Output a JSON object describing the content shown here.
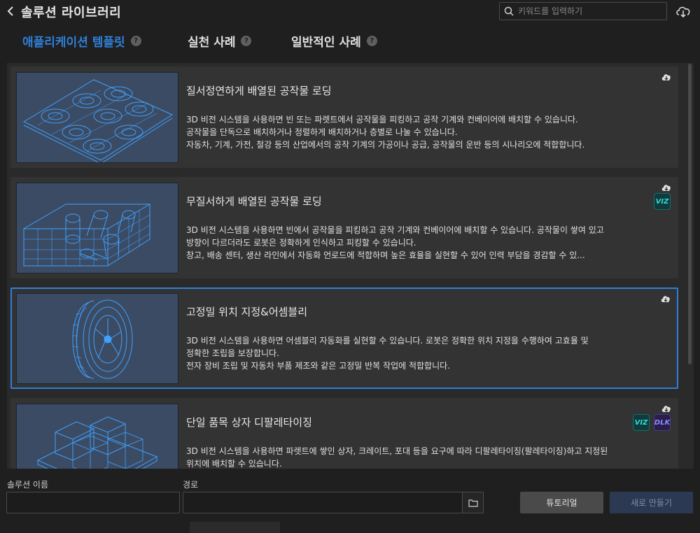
{
  "header": {
    "title": "솔루션 라이브러리",
    "search_placeholder": "키워드를 입력하기"
  },
  "tabs": [
    {
      "label": "애플리케이션 템플릿",
      "active": true
    },
    {
      "label": "실천 사례",
      "active": false
    },
    {
      "label": "일반적인 사례",
      "active": false
    }
  ],
  "tab_help_glyph": "?",
  "cards": [
    {
      "title": "질서정연하게 배열된 공작물 로딩",
      "desc": [
        "3D 비전 시스템을 사용하면 빈 또는 파렛트에서 공작물을 피킹하고 공작 기계와 컨베이어에 배치할 수 있습니다.",
        "공작물을 단독으로 배치하거나 정렬하게 배치하거나 층별로 나눌 수 있습니다.",
        "자동차, 기계, 가전, 철강 등의 산업에서의 공작 기계의 가공이나 공급, 공작물의 운반 등의 시나리오에 적합합니다."
      ],
      "badges": []
    },
    {
      "title": "무질서하게 배열된 공작물 로딩",
      "desc": [
        "3D 비전 시스템을 사용하면 빈에서 공작물을 피킹하고 공작 기계와 컨베이어에 배치할 수 있습니다. 공작물이 쌓여 있고",
        "방향이 다르더라도 로봇은 정확하게 인식하고 피킹할 수 있습니다.",
        "창고, 배송 센터, 생산 라인에서 자동화 언로드에 적합하며 높은 효율을 실현할 수 있어 인력 부담을 경감할 수 있..."
      ],
      "badges": [
        "VIZ"
      ]
    },
    {
      "title": "고정밀 위치 지정&어셈블리",
      "desc": [
        "3D 비전 시스템을 사용하면 어셈블리 자동화를 실현할 수 있습니다. 로봇은 정확한 위치 지정을 수행하여 고효율 및",
        "정확한 조립을 보장합니다.",
        "전자 장비 조립 및 자동차 부품 제조와 같은 고정밀 반복 작업에 적합합니다."
      ],
      "badges": []
    },
    {
      "title": "단일 품목 상자 디팔레타이징",
      "desc": [
        "3D 비전 시스템을 사용하면 파렛트에 쌓인 상자, 크레이트, 포대 등을 요구에 따라 디팔레타이징(팔레타이징)하고 지정된",
        "위치에 배치할 수 있습니다."
      ],
      "badges": [
        "VIZ",
        "DLK"
      ]
    }
  ],
  "footer": {
    "name_label": "솔루션 이름",
    "path_label": "경로",
    "name_value": "",
    "path_value": "",
    "tutorial_label": "튜토리얼",
    "create_label": "새로 만들기"
  },
  "colors": {
    "accent": "#2f7fd8",
    "card_bg": "#333333",
    "thumb_bg": "#3b4b63",
    "wireframe": "#3fa0ff"
  }
}
